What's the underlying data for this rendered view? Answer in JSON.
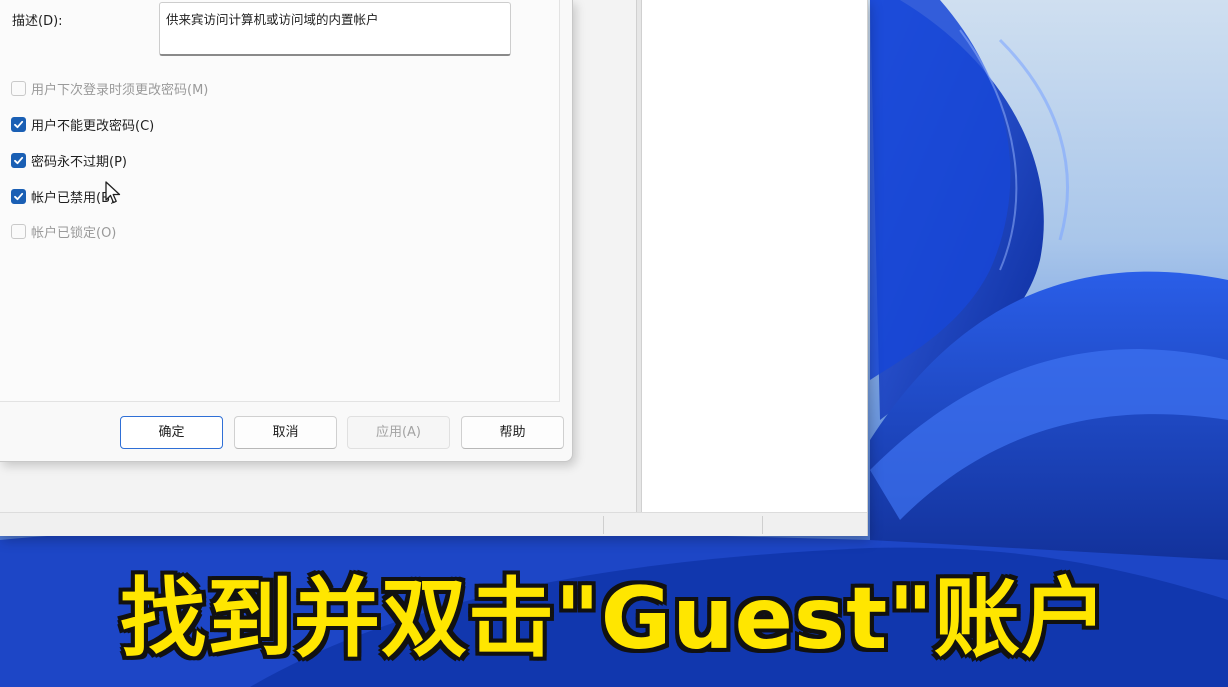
{
  "dialog": {
    "description_label": "描述(D):",
    "description_value": "供来宾访问计算机或访问域的内置帐户",
    "checkboxes": [
      {
        "label": "用户下次登录时须更改密码(M)",
        "checked": false,
        "disabled": true
      },
      {
        "label": "用户不能更改密码(C)",
        "checked": true,
        "disabled": false
      },
      {
        "label": "密码永不过期(P)",
        "checked": true,
        "disabled": false
      },
      {
        "label": "帐户已禁用(B)",
        "checked": true,
        "disabled": false
      },
      {
        "label": "帐户已锁定(O)",
        "checked": false,
        "disabled": true
      }
    ],
    "buttons": {
      "ok": "确定",
      "cancel": "取消",
      "apply": "应用(A)",
      "help": "帮助"
    }
  },
  "caption": "找到并双击\"Guest\"账户",
  "colors": {
    "accent": "#1a5fb4",
    "caption_text": "#ffe600",
    "caption_outline": "#111111"
  }
}
